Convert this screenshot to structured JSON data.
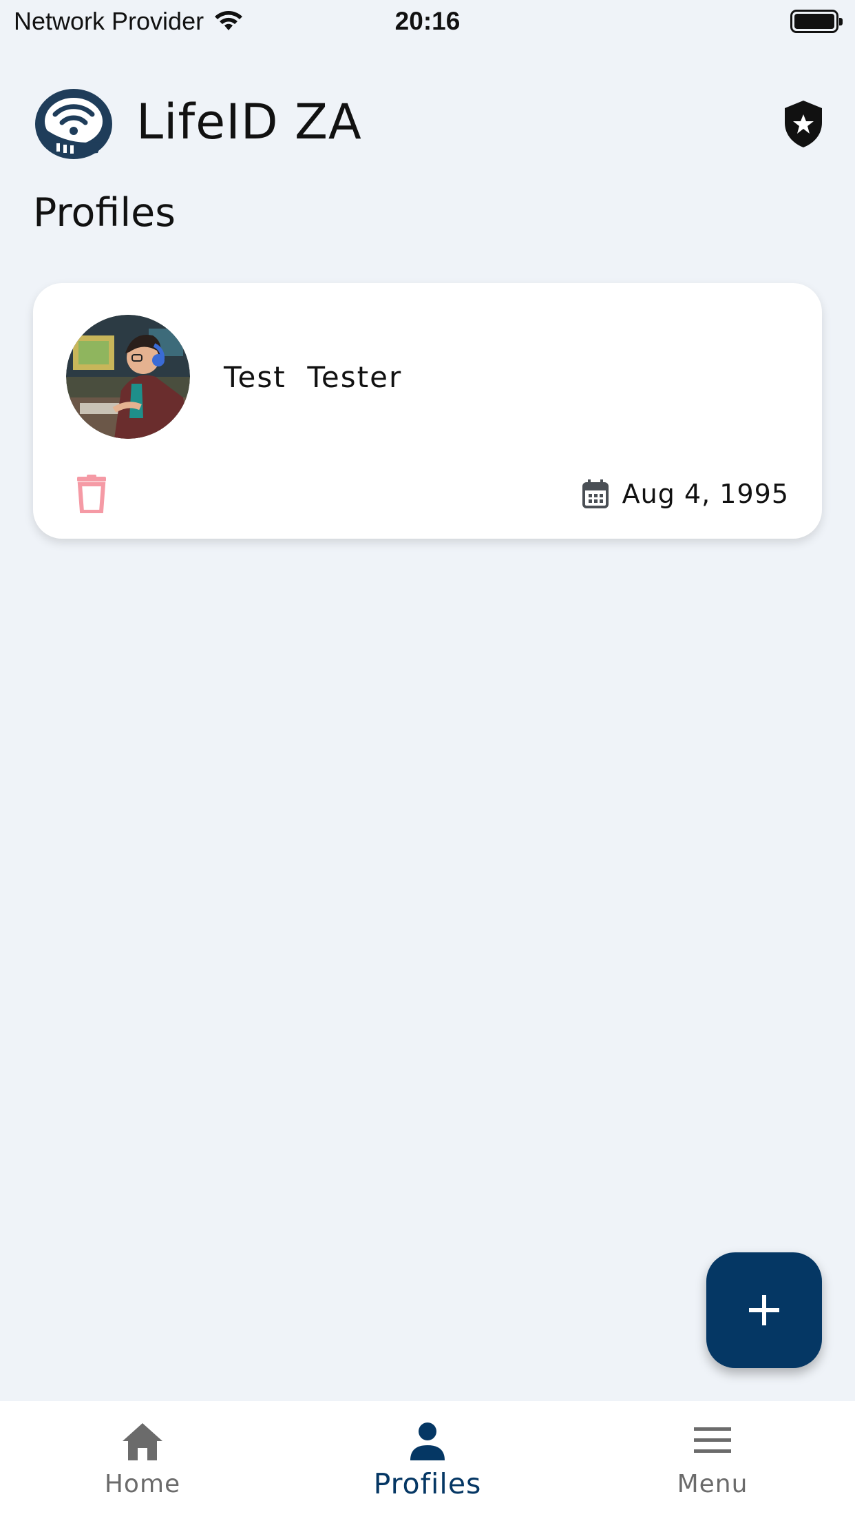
{
  "status_bar": {
    "carrier": "Network Provider",
    "time": "20:16"
  },
  "header": {
    "app_title": "LifeID ZA",
    "logo_icon": "lifeid-logo-icon",
    "action_icon": "shield-star-icon"
  },
  "page": {
    "title": "Profiles"
  },
  "profiles": [
    {
      "name": "Test  Tester",
      "date_of_birth": "Aug 4, 1995",
      "avatar_icon": "profile-avatar-illustration",
      "delete_icon": "trash-icon",
      "date_icon": "calendar-icon"
    }
  ],
  "fab": {
    "icon": "plus-icon"
  },
  "bottom_nav": {
    "items": [
      {
        "label": "Home",
        "icon": "home-icon",
        "active": false
      },
      {
        "label": "Profiles",
        "icon": "person-icon",
        "active": true
      },
      {
        "label": "Menu",
        "icon": "hamburger-menu-icon",
        "active": false
      }
    ]
  },
  "colors": {
    "background": "#eff3f8",
    "primary": "#053764",
    "delete": "#f59aa5",
    "nav_inactive": "#6b6b6b",
    "card": "#ffffff"
  }
}
